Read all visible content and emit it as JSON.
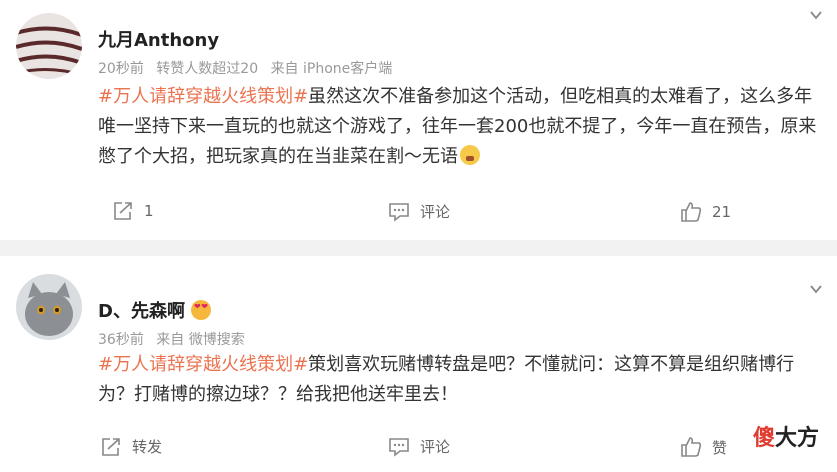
{
  "posts": [
    {
      "username": "九月Anthony",
      "meta": {
        "time": "20秒前",
        "extra": "转赞人数超过20",
        "source": "来自 iPhone客户端"
      },
      "hashtag": "#万人请辞穿越火线策划#",
      "text": "虽然这次不准备参加这个活动，但吃相真的太难看了，这么多年唯一坚持下来一直玩的也就这个游戏了，往年一套200也就不提了，今年一直在预告，原来憋了个大招，把玩家真的在当韭菜在割～无语",
      "actions": {
        "repost": "1",
        "comment": "评论",
        "like": "21"
      }
    },
    {
      "username": "D、先森啊",
      "meta": {
        "time": "36秒前",
        "source": "来自 微博搜索"
      },
      "hashtag": "#万人请辞穿越火线策划#",
      "text": "策划喜欢玩赌博转盘是吧？不懂就问：这算不算是组织赌博行为？打赌博的擦边球？？给我把他送牢里去！",
      "actions": {
        "repost": "转发",
        "comment": "评论",
        "like": "赞"
      }
    }
  ],
  "watermark": {
    "red": "傻",
    "black": "大方"
  },
  "colors": {
    "hashtag": "#eb7350",
    "meta": "#999999",
    "divider": "#f2f2f2"
  },
  "icons": [
    "chevron-down-icon",
    "repost-icon",
    "comment-icon",
    "like-icon",
    "angry-emoji-icon",
    "heart-eyes-emoji-icon"
  ]
}
